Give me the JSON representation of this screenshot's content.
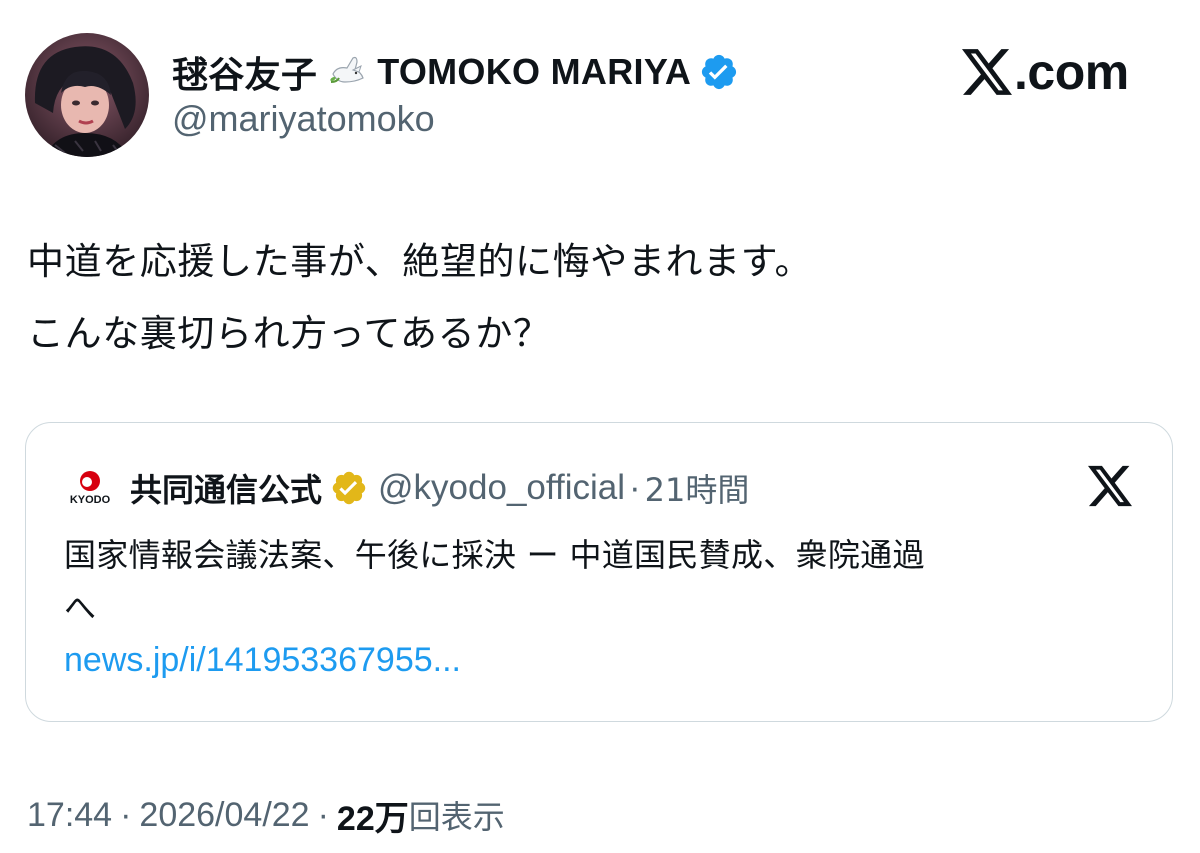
{
  "author": {
    "display_name_jp": "毬谷友子",
    "display_name_en": "TOMOKO MARIYA",
    "handle": "@mariyatomoko",
    "avatar_icon": "profile-photo",
    "name_emoji_icon": "dove-icon",
    "verified_icon": "verified-badge-icon"
  },
  "brand": {
    "x_icon": "x-logo-icon",
    "text": ".com"
  },
  "tweet": {
    "lines": [
      "中道を応援した事が、絶望的に悔やまれます。",
      "こんな裏切られ方ってあるか？"
    ]
  },
  "quote": {
    "logo_text": "KYODO",
    "name": "共同通信公式",
    "handle": "@kyodo_official",
    "separator": "·",
    "time": "21時間",
    "text_lines": [
      "国家情報会議法案、午後に採決 ー 中道国民賛成、衆院通過",
      "へ"
    ],
    "link": "news.jp/i/141953367955..."
  },
  "meta": {
    "time": "17:44",
    "separator": "·",
    "date": "2026/04/22",
    "views_count": "22万",
    "views_label": "回表示"
  },
  "colors": {
    "text": "#0f1419",
    "secondary": "#536471",
    "link": "#1d9bf0",
    "verified_blue": "#1d9bf0",
    "verified_gold": "#e2b719",
    "kyodo_red": "#d7000f",
    "border": "#cfd9de"
  }
}
